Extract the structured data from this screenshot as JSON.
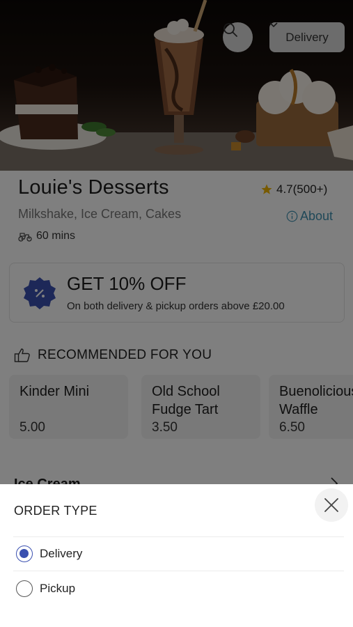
{
  "header": {
    "order_type_button": "Delivery"
  },
  "restaurant": {
    "name": "Louie's Desserts",
    "rating": "4.7(500+)",
    "cuisines": "Milkshake, Ice Cream, Cakes",
    "about_label": "About",
    "eta": "60 mins"
  },
  "promo": {
    "title": "GET 10% OFF",
    "subtitle": "On both delivery & pickup orders above £20.00"
  },
  "recommended": {
    "heading": "RECOMMENDED FOR YOU",
    "items": [
      {
        "name": "Kinder Mini",
        "price": "5.00"
      },
      {
        "name": "Old School\nFudge Tart",
        "price": "3.50"
      },
      {
        "name": "Buenolicious\nWaffle",
        "price": "6.50"
      }
    ]
  },
  "menu_section": {
    "label": "Ice Cream"
  },
  "order_sheet": {
    "title": "ORDER TYPE",
    "options": [
      {
        "label": "Delivery",
        "selected": true
      },
      {
        "label": "Pickup",
        "selected": false
      }
    ]
  },
  "colors": {
    "accent": "#3a50b0",
    "link": "#3f90b0",
    "star": "#f0b400",
    "overlay": "rgba(0,0,0,0.5)"
  },
  "icons": [
    "search-icon",
    "chevron-down-icon",
    "star-icon",
    "info-icon",
    "scooter-icon",
    "percent-badge-icon",
    "thumbs-up-icon",
    "chevron-right-icon",
    "close-icon"
  ]
}
